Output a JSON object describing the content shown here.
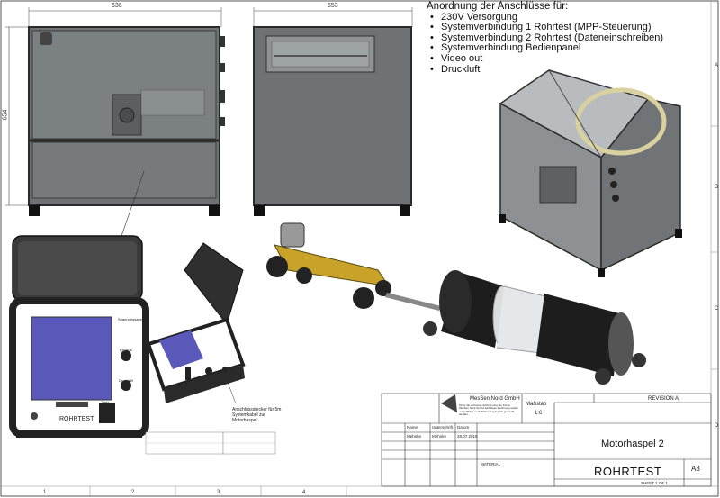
{
  "dimensions": {
    "front_width": "636",
    "side_width": "553",
    "height": "654"
  },
  "notes": {
    "heading": "Anordnung der Anschlüsse für:",
    "items": [
      "230V Versorgung",
      "Systemverbindung 1 Rohrtest (MPP-Steuerung)",
      "Systemverbindung 2 Rohrtest (Dateneinschreiben)",
      "Systemverbindung Bedienpanel",
      "Video out",
      "Druckluft"
    ]
  },
  "case_panel": {
    "title": "ROHRTEST",
    "small_labels": [
      "Spannungsanzeige",
      "Ein/Aus",
      "Netz",
      "Druckluft",
      "ROHRTEST"
    ]
  },
  "connector_note": "Anschlussstecker für 5m Systemkabel zur Motorhaspel",
  "title_block": {
    "company": "MesSen Nord GmbH",
    "disclaimer": "Ohne die vorherige Zustimmung der Firma MesSen Nord GmbH darf diese Zeichnung weder vervielfältigt, noch Dritten zugänglich gemacht werden.",
    "scale_label": "Maßstab",
    "scale": "1:6",
    "revision": "REVISION A",
    "name_label": "Name",
    "signature_label": "Unterschrift",
    "date_label": "Datum",
    "name": "Mehnke",
    "signature": "Mehnke",
    "date": "28.07.2015",
    "drawing_name": "Motorhaspel 2",
    "material_label": "MATERIAL",
    "product": "ROHRTEST",
    "format": "A3",
    "sheet": "SHEET 1 OF 1"
  },
  "grid": {
    "columns": [
      "1",
      "2",
      "3",
      "4"
    ],
    "rows": [
      "A",
      "B",
      "C",
      "D"
    ]
  },
  "colors": {
    "frame": "#3c3c3c",
    "panel": "#6e7275",
    "screen": "#5a58b8",
    "yellow": "#c9a22a",
    "tube": "#1d1d1d"
  }
}
